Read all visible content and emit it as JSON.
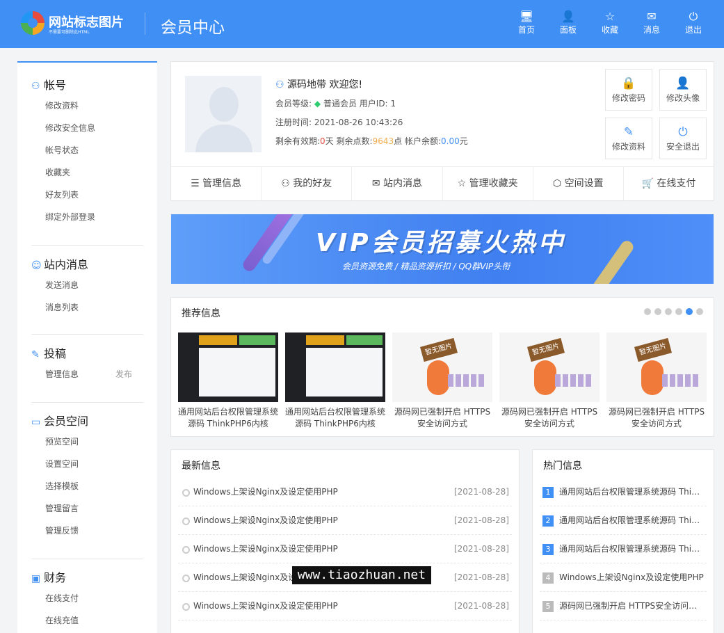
{
  "header": {
    "logo_text": "网站标志图片",
    "logo_sub": "不需要可删除此HTML",
    "title": "会员中心",
    "nav": [
      {
        "icon": "monitor-icon",
        "glyph": "🖥",
        "label": "首页"
      },
      {
        "icon": "user-icon",
        "glyph": "👤",
        "label": "面板"
      },
      {
        "icon": "star-icon",
        "glyph": "☆",
        "label": "收藏"
      },
      {
        "icon": "mail-icon",
        "glyph": "✉",
        "label": "消息"
      },
      {
        "icon": "power-icon",
        "glyph": "⏻",
        "label": "退出"
      }
    ]
  },
  "sidebar": {
    "groups": [
      {
        "icon": "user-icon",
        "glyph": "⚇",
        "title": "帐号",
        "links": [
          {
            "label": "修改资料"
          },
          {
            "label": "修改安全信息"
          },
          {
            "label": "帐号状态"
          },
          {
            "label": "收藏夹"
          },
          {
            "label": "好友列表"
          },
          {
            "label": "绑定外部登录"
          }
        ]
      },
      {
        "icon": "chat-icon",
        "glyph": "☺",
        "title": "站内消息",
        "links": [
          {
            "label": "发送消息"
          },
          {
            "label": "消息列表"
          }
        ]
      },
      {
        "icon": "pen-icon",
        "glyph": "✎",
        "title": "投稿",
        "links": [
          {
            "label": "管理信息",
            "extra": "发布"
          }
        ]
      },
      {
        "icon": "monitor-icon",
        "glyph": "▭",
        "title": "会员空间",
        "links": [
          {
            "label": "预览空间"
          },
          {
            "label": "设置空间"
          },
          {
            "label": "选择模板"
          },
          {
            "label": "管理留言"
          },
          {
            "label": "管理反馈"
          }
        ]
      },
      {
        "icon": "wallet-icon",
        "glyph": "▣",
        "title": "财务",
        "links": [
          {
            "label": "在线支付"
          },
          {
            "label": "在线充值"
          }
        ]
      }
    ]
  },
  "profile": {
    "welcome": "源码地带 欢迎您!",
    "level_label": "会员等级:",
    "level_value": "普通会员",
    "uid_label": "用户ID:",
    "uid_value": "1",
    "reg_label": "注册时间:",
    "reg_value": "2021-08-26 10:43:26",
    "remain_label": "剩余有效期:",
    "remain_days": "0",
    "remain_unit": "天",
    "points_label": "剩余点数:",
    "points_value": "9643",
    "points_unit": "点",
    "balance_label": "帐户余额:",
    "balance_value": "0.00",
    "balance_unit": "元",
    "quick": [
      {
        "icon": "lock-icon",
        "glyph": "🔒",
        "label": "修改密码"
      },
      {
        "icon": "user-edit-icon",
        "glyph": "👤",
        "label": "修改头像"
      },
      {
        "icon": "edit-icon",
        "glyph": "✎",
        "label": "修改资料"
      },
      {
        "icon": "power-icon",
        "glyph": "⏻",
        "label": "安全退出"
      }
    ],
    "tabs": [
      {
        "icon": "list-icon",
        "glyph": "☰",
        "label": "管理信息"
      },
      {
        "icon": "user-icon",
        "glyph": "⚇",
        "label": "我的好友"
      },
      {
        "icon": "mail-icon",
        "glyph": "✉",
        "label": "站内消息"
      },
      {
        "icon": "star-icon",
        "glyph": "☆",
        "label": "管理收藏夹"
      },
      {
        "icon": "cube-icon",
        "glyph": "⬡",
        "label": "空间设置"
      },
      {
        "icon": "cart-icon",
        "glyph": "🛒",
        "label": "在线支付"
      }
    ]
  },
  "banner": {
    "title": "VIP会员招募火热中",
    "subtitle": "会员资源免费 / 精品资源折扣 / QQ群VIP头衔"
  },
  "recommend": {
    "title": "推荐信息",
    "active_dot": 4,
    "dot_count": 6,
    "items": [
      {
        "type": "dark",
        "caption": "通用网站后台权限管理系统源码 ThinkPHP6内核"
      },
      {
        "type": "dark",
        "caption": "通用网站后台权限管理系统源码 ThinkPHP6内核"
      },
      {
        "type": "light",
        "sign": "暂无图片",
        "caption": "源码网已强制开启 HTTPS安全访问方式"
      },
      {
        "type": "light",
        "sign": "暂无图片",
        "caption": "源码网已强制开启 HTTPS安全访问方式"
      },
      {
        "type": "light",
        "sign": "暂无图片",
        "caption": "源码网已强制开启 HTTPS安全访问方式"
      }
    ]
  },
  "news": {
    "title": "最新信息",
    "items": [
      {
        "text": "Windows上架设Nginx及设定使用PHP",
        "date": "[2021-08-28]"
      },
      {
        "text": "Windows上架设Nginx及设定使用PHP",
        "date": "[2021-08-28]"
      },
      {
        "text": "Windows上架设Nginx及设定使用PHP",
        "date": "[2021-08-28]"
      },
      {
        "text": "Windows上架设Nginx及设定使用PHP",
        "date": "[2021-08-28]"
      },
      {
        "text": "Windows上架设Nginx及设定使用PHP",
        "date": "[2021-08-28]"
      }
    ]
  },
  "hot": {
    "title": "热门信息",
    "items": [
      {
        "rank": "1",
        "text": "通用网站后台权限管理系统源码 Thi…"
      },
      {
        "rank": "2",
        "text": "通用网站后台权限管理系统源码 Thi…"
      },
      {
        "rank": "3",
        "text": "通用网站后台权限管理系统源码 Thi…"
      },
      {
        "rank": "4",
        "text": "Windows上架设Nginx及设定使用PHP"
      },
      {
        "rank": "5",
        "text": "源码网已强制开启 HTTPS安全访问…"
      }
    ]
  },
  "watermark": "www.tiaozhuan.net",
  "colors": {
    "accent": "#3f8ff5",
    "points": "#f0ad4e",
    "days": "#e74c3c"
  }
}
